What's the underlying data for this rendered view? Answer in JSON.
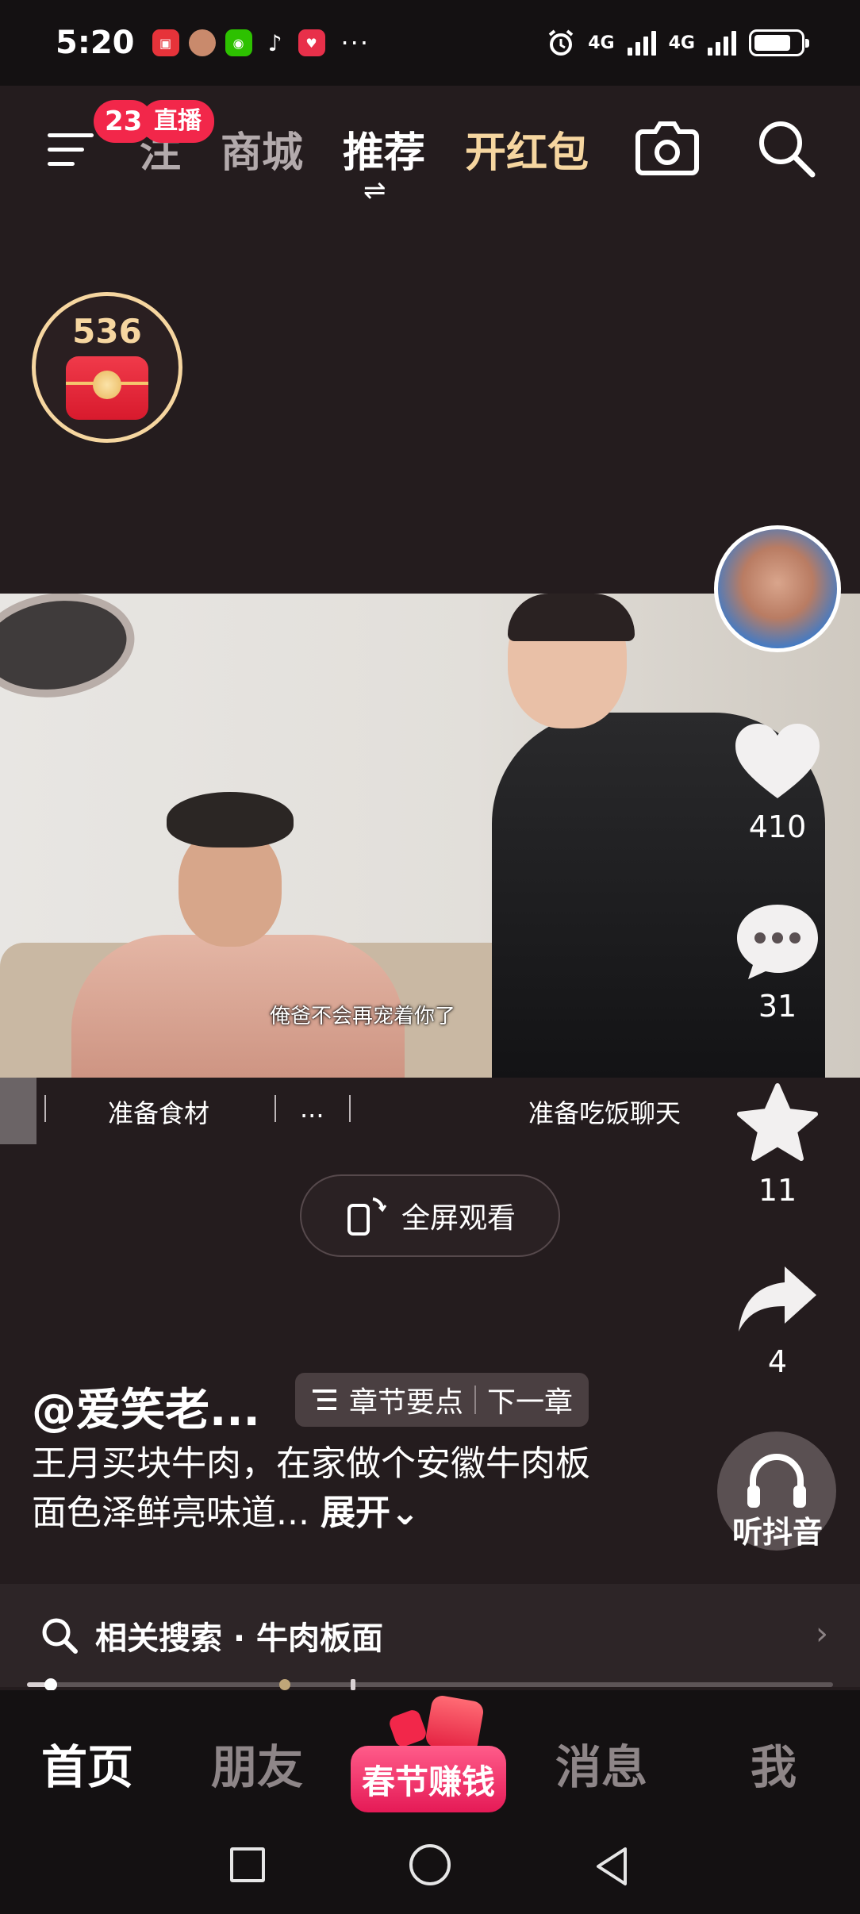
{
  "status_bar": {
    "time": "5:20",
    "network_1": "4G",
    "network_2": "4G",
    "more": "···"
  },
  "top_nav": {
    "unread_count": "23",
    "live_badge": "直播",
    "tab_follow_partial": "注",
    "tabs": [
      "商城",
      "推荐",
      "开红包"
    ],
    "switch_glyph": "⇌"
  },
  "red_packet": {
    "count": "536"
  },
  "video": {
    "subtitle": "俺爸不会再宠着你了",
    "chapters": [
      "准备食材",
      "...",
      "准备吃饭聊天"
    ]
  },
  "fullscreen": {
    "label": "全屏观看"
  },
  "rail": {
    "likes": "410",
    "comments": "31",
    "favorites": "11",
    "shares": "4",
    "listen_label": "听抖音"
  },
  "caption": {
    "author": "@爱笑老...",
    "chapter_points": "章节要点",
    "next_chapter": "下一章",
    "description": "王月买块牛肉，在家做个安徽牛肉板面色泽鲜亮味道...",
    "expand": "展开"
  },
  "related_search": {
    "label": "相关搜索 · 牛肉板面"
  },
  "progress": {
    "played_fraction": 0.03
  },
  "bottom_nav": {
    "home": "首页",
    "friends": "朋友",
    "spring": "春节赚钱",
    "messages": "消息",
    "me": "我"
  },
  "colors": {
    "background": "#241c1e",
    "accent_red": "#f2274a",
    "gold": "#f6d6a0"
  }
}
